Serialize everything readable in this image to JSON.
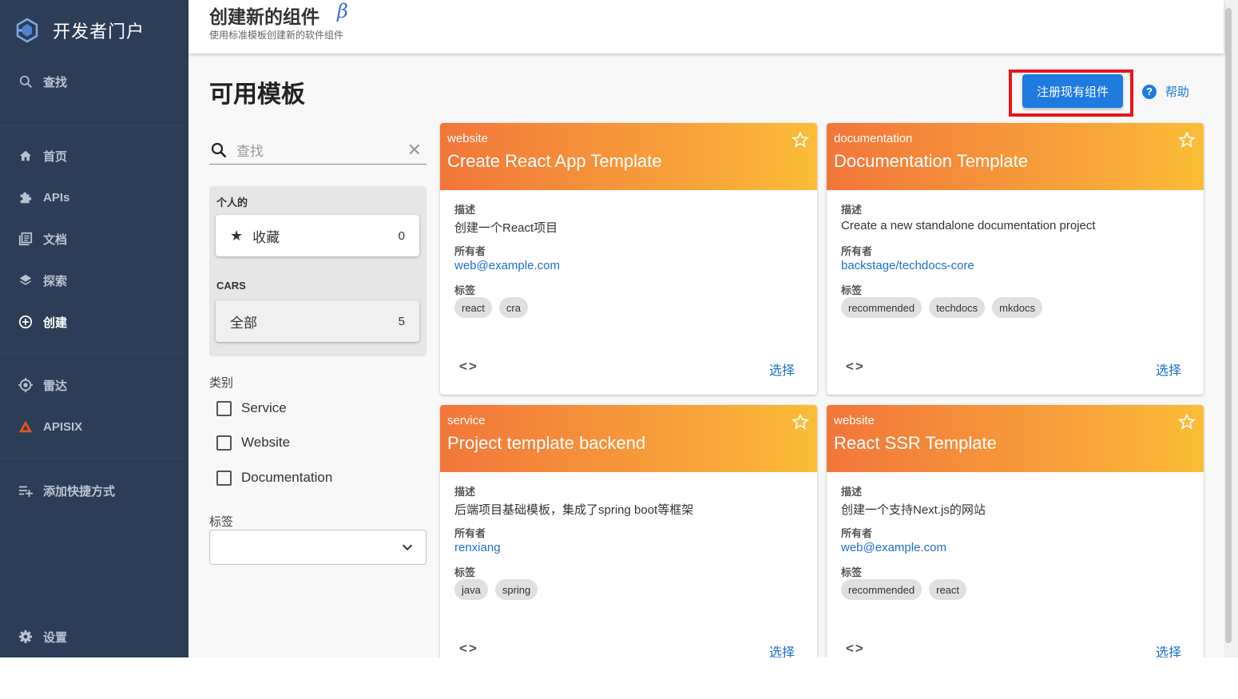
{
  "sidebar": {
    "app_name": "开发者门户",
    "search_label": "查找",
    "items": [
      {
        "label": "首页",
        "icon": "home-icon"
      },
      {
        "label": "APIs",
        "icon": "puzzle-icon"
      },
      {
        "label": "文档",
        "icon": "library-icon"
      },
      {
        "label": "探索",
        "icon": "layers-icon"
      },
      {
        "label": "创建",
        "icon": "add-circle-icon"
      },
      {
        "label": "雷达",
        "icon": "radar-icon"
      },
      {
        "label": "APISIX",
        "icon": "apisix-icon"
      },
      {
        "label": "添加快捷方式",
        "icon": "playlist-add-icon"
      },
      {
        "label": "设置",
        "icon": "gear-icon"
      }
    ]
  },
  "header": {
    "title": "创建新的组件",
    "beta": "β",
    "subtitle": "使用标准模板创建新的软件组件"
  },
  "main": {
    "heading": "可用模板",
    "register_label": "注册现有组件",
    "help_label": "帮助"
  },
  "filters": {
    "search_placeholder": "查找",
    "personal_label": "个人的",
    "favorites_label": "收藏",
    "favorites_count": "0",
    "cars_label": "CARS",
    "all_label": "全部",
    "all_count": "5",
    "category_label": "类别",
    "categories": [
      "Service",
      "Website",
      "Documentation"
    ],
    "tags_label": "标签"
  },
  "card_labels": {
    "description": "描述",
    "owner": "所有者",
    "tags": "标签",
    "choose": "选择"
  },
  "templates": [
    {
      "type": "website",
      "title": "Create React App Template",
      "description": "创建一个React项目",
      "owner": "web@example.com",
      "tags": [
        "react",
        "cra"
      ]
    },
    {
      "type": "documentation",
      "title": "Documentation Template",
      "description": "Create a new standalone documentation project",
      "owner": "backstage/techdocs-core",
      "tags": [
        "recommended",
        "techdocs",
        "mkdocs"
      ]
    },
    {
      "type": "service",
      "title": "Project template backend",
      "description": "后端项目基础模板，集成了spring boot等框架",
      "owner": "renxiang",
      "tags": [
        "java",
        "spring"
      ]
    },
    {
      "type": "website",
      "title": "React SSR Template",
      "description": "创建一个支持Next.js的网站",
      "owner": "web@example.com",
      "tags": [
        "recommended",
        "react"
      ]
    }
  ],
  "colors": {
    "sidebar_bg": "#2c3e57",
    "accent": "#1e7be0",
    "card_gradient_start": "#f2763a",
    "card_gradient_end": "#fbbd35",
    "highlight_border": "#e8141a"
  }
}
